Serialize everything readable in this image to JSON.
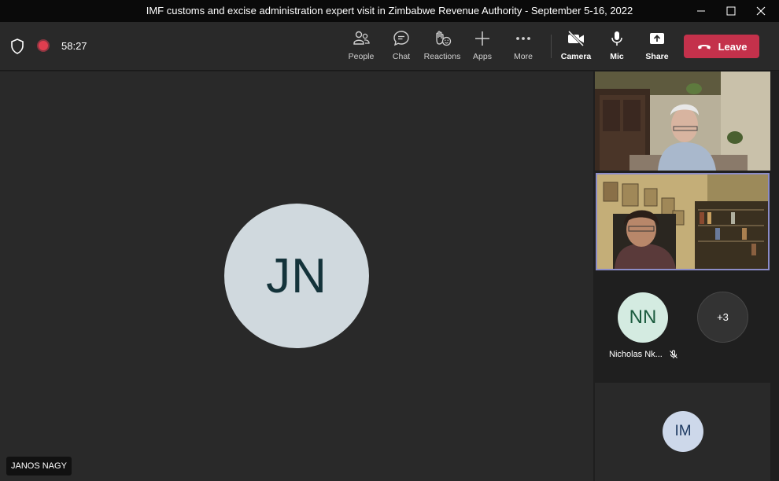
{
  "window": {
    "title": "IMF customs and excise administration expert visit in Zimbabwe Revenue Authority - September 5-16, 2022"
  },
  "toolbar": {
    "timer": "58:27",
    "people": "People",
    "chat": "Chat",
    "reactions": "Reactions",
    "apps": "Apps",
    "more": "More",
    "camera": "Camera",
    "mic": "Mic",
    "share": "Share",
    "leave": "Leave"
  },
  "stage": {
    "initials": "JN",
    "name": "JANOS NAGY"
  },
  "side": {
    "participant_initials": "NN",
    "participant_name": "Nicholas Nk...",
    "overflow_count": "+3",
    "bottom_initials": "IM"
  },
  "colors": {
    "leave_red": "#c4314b",
    "active_tile_border": "#8b8cc7",
    "recording_red": "#e03e4f"
  }
}
